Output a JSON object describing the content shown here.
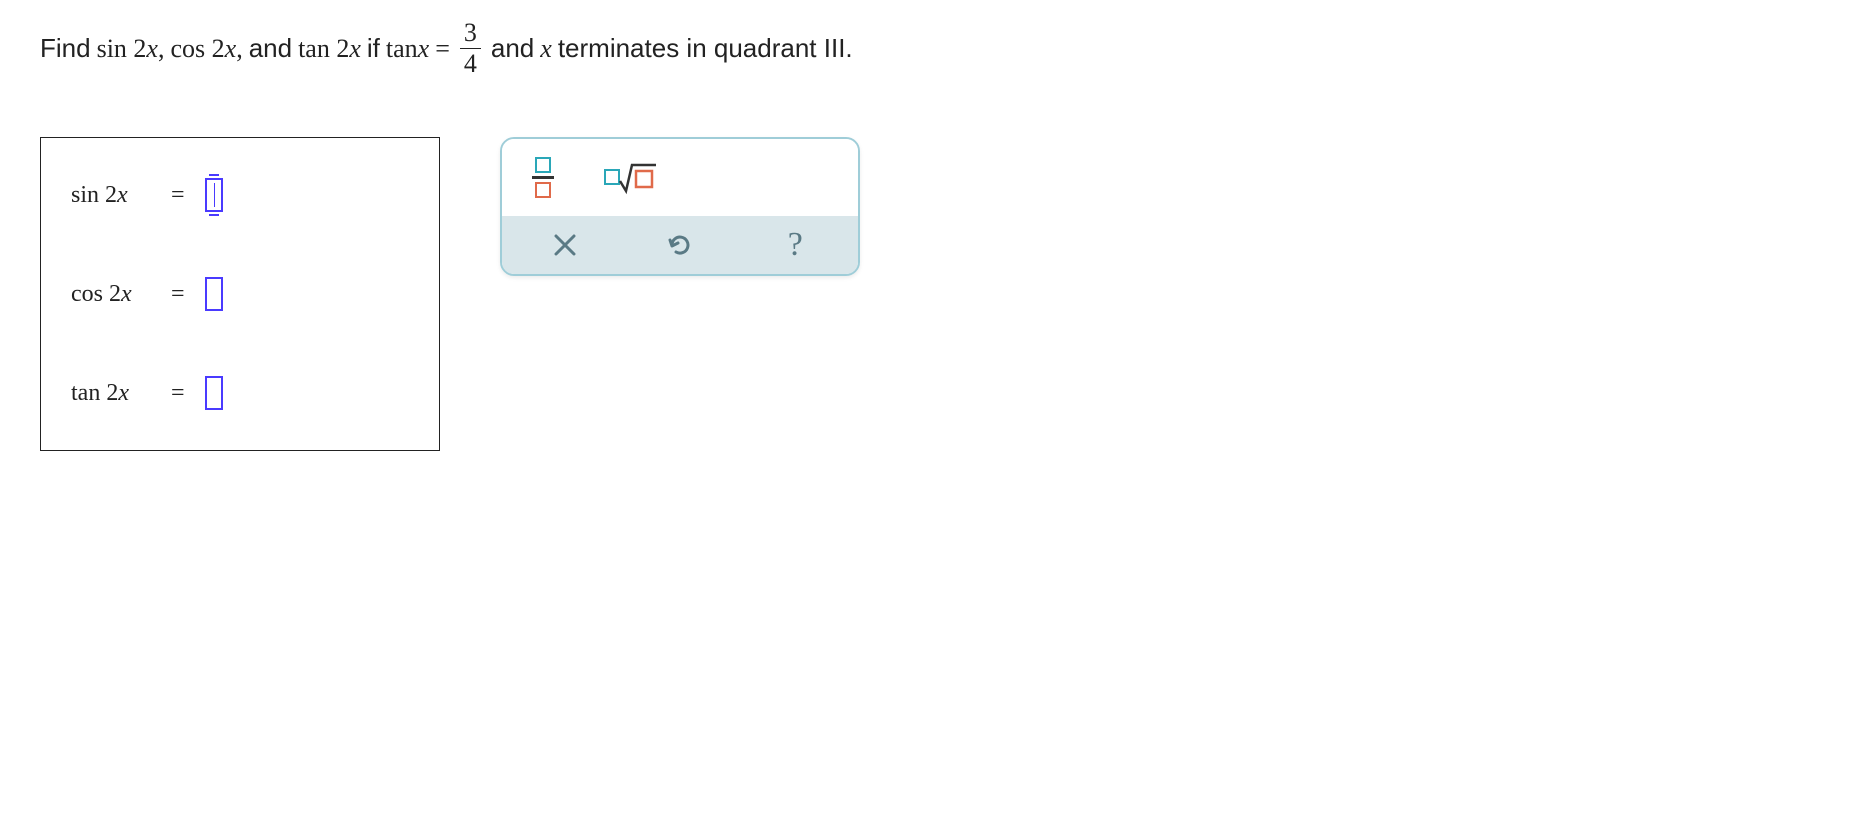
{
  "problem": {
    "lead_word": "Find",
    "expr1": "sin 2",
    "var": "x",
    "comma1": ",",
    "expr2": "cos 2",
    "comma2": ",",
    "and_word": "and",
    "expr3": "tan 2",
    "if_word": "if",
    "tanx": "tan",
    "equals": "=",
    "frac_num": "3",
    "frac_den": "4",
    "and2": "and",
    "terminates": "terminates in quadrant III."
  },
  "answers": {
    "row1_label_fn": "sin 2",
    "row2_label_fn": "cos 2",
    "row3_label_fn": "tan 2",
    "var": "x",
    "eq": "=",
    "val1": "",
    "val2": "",
    "val3": ""
  },
  "palette": {
    "fraction_tool": "fraction",
    "sqrt_tool": "square-root",
    "clear": "×",
    "undo": "↺",
    "help": "?"
  }
}
